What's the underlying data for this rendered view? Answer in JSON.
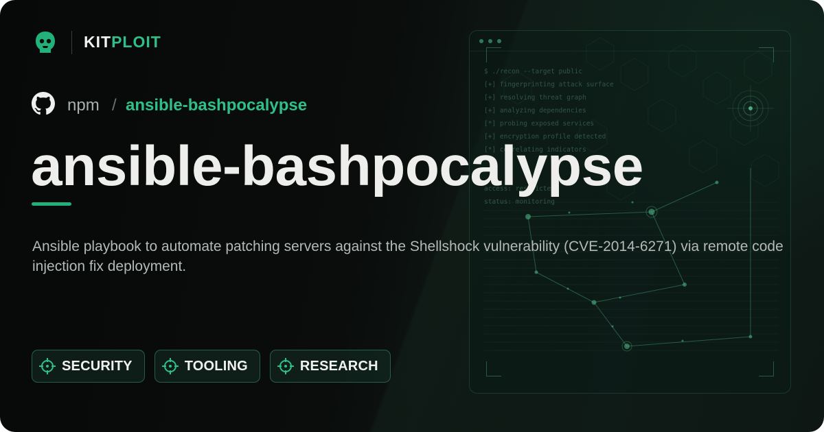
{
  "brand": {
    "name_part1": "KIT",
    "name_part2": "PLOIT"
  },
  "breadcrumb": {
    "root": "npm",
    "separator": "/",
    "repo": "ansible-bashpocalypse"
  },
  "title": "ansible-bashpocalypse",
  "description": "Ansible playbook to automate patching servers against the Shellshock vulnerability (CVE-2014-6271) via remote code injection fix deployment.",
  "tags": [
    {
      "label": "SECURITY",
      "icon": "crosshair-icon"
    },
    {
      "label": "TOOLING",
      "icon": "crosshair-icon"
    },
    {
      "label": "RESEARCH",
      "icon": "crosshair-icon"
    }
  ],
  "terminal": {
    "lines": [
      "$ ./recon --target public",
      "[+] fingerprinting attack surface",
      "[+] resolving threat graph",
      "[+] analyzing dependencies",
      "[*] probing exposed services",
      "[+] encryption profile detected",
      "[*] correlating indicators",
      "",
      "",
      "access: restricted",
      "status: monitoring"
    ]
  },
  "colors": {
    "accent": "#2fc08a",
    "background": "#0a0d0c",
    "title": "#eeefec"
  }
}
